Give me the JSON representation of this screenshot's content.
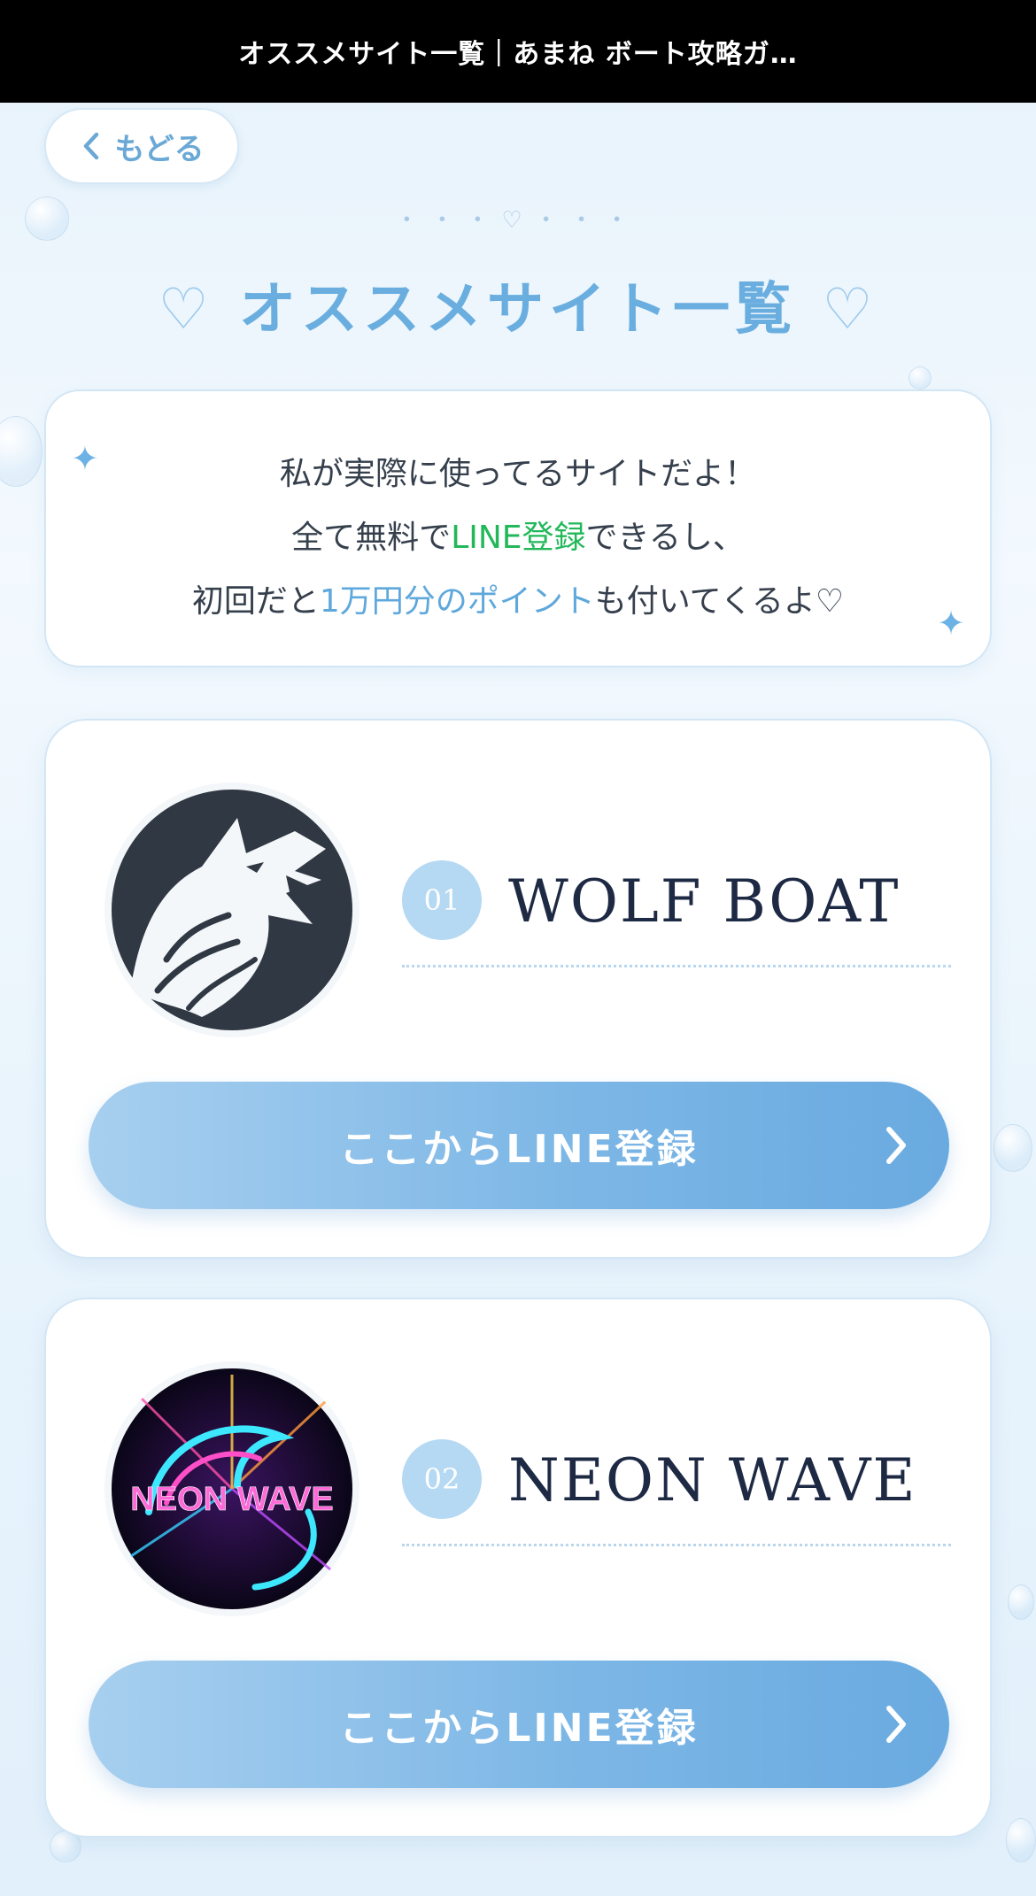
{
  "header": {
    "title": "オススメサイト一覧｜あまね ボート攻略ガ…"
  },
  "back": {
    "label": "もどる"
  },
  "hero": {
    "dots": "・・・♡・・・",
    "heart_left": "♡",
    "title": "オススメサイト一覧",
    "heart_right": "♡"
  },
  "intro": {
    "line1": "私が実際に使ってるサイトだよ！",
    "line2_prefix": "全て無料で",
    "line2_highlight": "LINE登録",
    "line2_suffix": "できるし、",
    "line3_prefix": "初回だと",
    "line3_highlight": "1万円分のポイント",
    "line3_suffix": "も付いてくるよ♡"
  },
  "sites": [
    {
      "number": "01",
      "name": "WOLF BOAT",
      "cta": "ここからLINE登録",
      "logo_icon": "wolf-logo-icon"
    },
    {
      "number": "02",
      "name": "NEON WAVE",
      "logo_text": "NEON WAVE",
      "cta": "ここからLINE登録",
      "logo_icon": "neon-wave-logo-icon"
    }
  ],
  "colors": {
    "accent_blue": "#6aaee0",
    "line_green": "#22b85a",
    "navy_text": "#1e2a44",
    "button_gradient_end": "#69aae0"
  }
}
